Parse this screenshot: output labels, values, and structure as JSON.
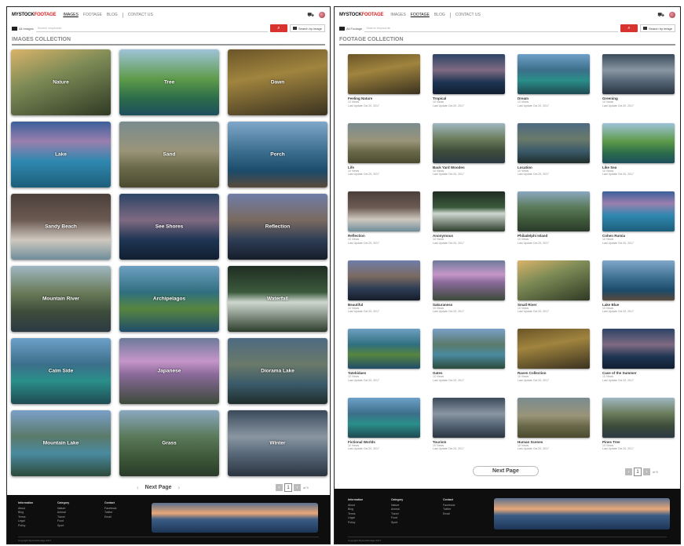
{
  "left": {
    "logo": {
      "a": "MYSTOCK",
      "b": "FOOTAGE"
    },
    "nav": [
      "IMAGES",
      "FOOTAGE",
      "BLOG",
      "CONTACT US"
    ],
    "active_nav": 0,
    "search_type": "All Images",
    "search_placeholder": "Search keywords",
    "search_btn": "⌕",
    "visual_search": "Search by image",
    "collection_title": "IMAGES COLLECTION",
    "tiles": [
      "Nature",
      "Tree",
      "Dawn",
      "Lake",
      "Sand",
      "Porch",
      "Sandy Beach",
      "See Shores",
      "Reflection",
      "Mountain River",
      "Archipelagos",
      "Waterfall",
      "Calm Side",
      "Japanese",
      "Diorama Lake",
      "Mountain Lake",
      "Grass",
      "Winter"
    ],
    "next_page": "Next Page",
    "page": "1",
    "page_of": "of 5"
  },
  "right": {
    "logo": {
      "a": "MYSTOCK",
      "b": "FOOTAGE"
    },
    "nav": [
      "IMAGES",
      "FOOTAGE",
      "BLOG",
      "CONTACT US"
    ],
    "active_nav": 1,
    "search_type": "All Footage",
    "search_placeholder": "Search keywords",
    "search_btn": "⌕",
    "visual_search": "Search by image",
    "collection_title": "FOOTAGE COLLECTION",
    "cards": [
      {
        "title": "Feeling Nature",
        "sub": "10 Views",
        "date": "Last Update Oct 20, 2017"
      },
      {
        "title": "Tropical",
        "sub": "10 Views",
        "date": "Last Update Oct 20, 2017"
      },
      {
        "title": "Dream",
        "sub": "10 Views",
        "date": "Last Update Oct 20, 2017"
      },
      {
        "title": "Greening",
        "sub": "10 Views",
        "date": "Last Update Oct 20, 2017"
      },
      {
        "title": "Life",
        "sub": "10 Views",
        "date": "Last Update Oct 20, 2017"
      },
      {
        "title": "Back Yard Wooden",
        "sub": "10 Views",
        "date": "Last Update Oct 20, 2017"
      },
      {
        "title": "Location",
        "sub": "10 Views",
        "date": "Last Update Oct 20, 2017"
      },
      {
        "title": "Like Sea",
        "sub": "10 Views",
        "date": "Last Update Oct 20, 2017"
      },
      {
        "title": "Reflection",
        "sub": "10 Views",
        "date": "Last Update Oct 20, 2017"
      },
      {
        "title": "Anonymous",
        "sub": "10 Views",
        "date": "Last Update Oct 20, 2017"
      },
      {
        "title": "Philadelphi Island",
        "sub": "10 Views",
        "date": "Last Update Oct 20, 2017"
      },
      {
        "title": "Cohen Rumia",
        "sub": "10 Views",
        "date": "Last Update Oct 20, 2017"
      },
      {
        "title": "Beautiful",
        "sub": "10 Views",
        "date": "Last Update Oct 20, 2017"
      },
      {
        "title": "Sakuraness",
        "sub": "10 Views",
        "date": "Last Update Oct 20, 2017"
      },
      {
        "title": "Small River",
        "sub": "10 Views",
        "date": "Last Update Oct 20, 2017"
      },
      {
        "title": "Lake Blue",
        "sub": "10 Views",
        "date": "Last Update Oct 20, 2017"
      },
      {
        "title": "Tatebidaes",
        "sub": "10 Views",
        "date": "Last Update Oct 20, 2017"
      },
      {
        "title": "Gates",
        "sub": "10 Views",
        "date": "Last Update Oct 20, 2017"
      },
      {
        "title": "Raven Collection",
        "sub": "10 Views",
        "date": "Last Update Oct 20, 2017"
      },
      {
        "title": "Case of the Summer",
        "sub": "10 Views",
        "date": "Last Update Oct 20, 2017"
      },
      {
        "title": "Fictional Worlds",
        "sub": "10 Views",
        "date": "Last Update Oct 20, 2017"
      },
      {
        "title": "Tourism",
        "sub": "10 Views",
        "date": "Last Update Oct 20, 2017"
      },
      {
        "title": "Human Scenes",
        "sub": "10 Views",
        "date": "Last Update Oct 20, 2017"
      },
      {
        "title": "Pines Tree",
        "sub": "10 Views",
        "date": "Last Update Oct 20, 2017"
      }
    ],
    "next_page": "Next Page",
    "page": "1",
    "page_of": "of 5"
  },
  "footer": {
    "col1": {
      "head": "Information",
      "items": [
        "About",
        "Blog",
        "Terms",
        "Legal",
        "Policy"
      ]
    },
    "col2": {
      "head": "Category",
      "items": [
        "Nature",
        "Animal",
        "Travel",
        "Food",
        "Sport"
      ]
    },
    "col3": {
      "head": "Contact",
      "items": [
        "Facebook",
        "Twitter",
        "Email"
      ]
    },
    "copyright": "Copyright Mystockfootage 2017"
  },
  "colors": {
    "accent": "#d9332f",
    "footer_bg": "#0e0e0e"
  }
}
